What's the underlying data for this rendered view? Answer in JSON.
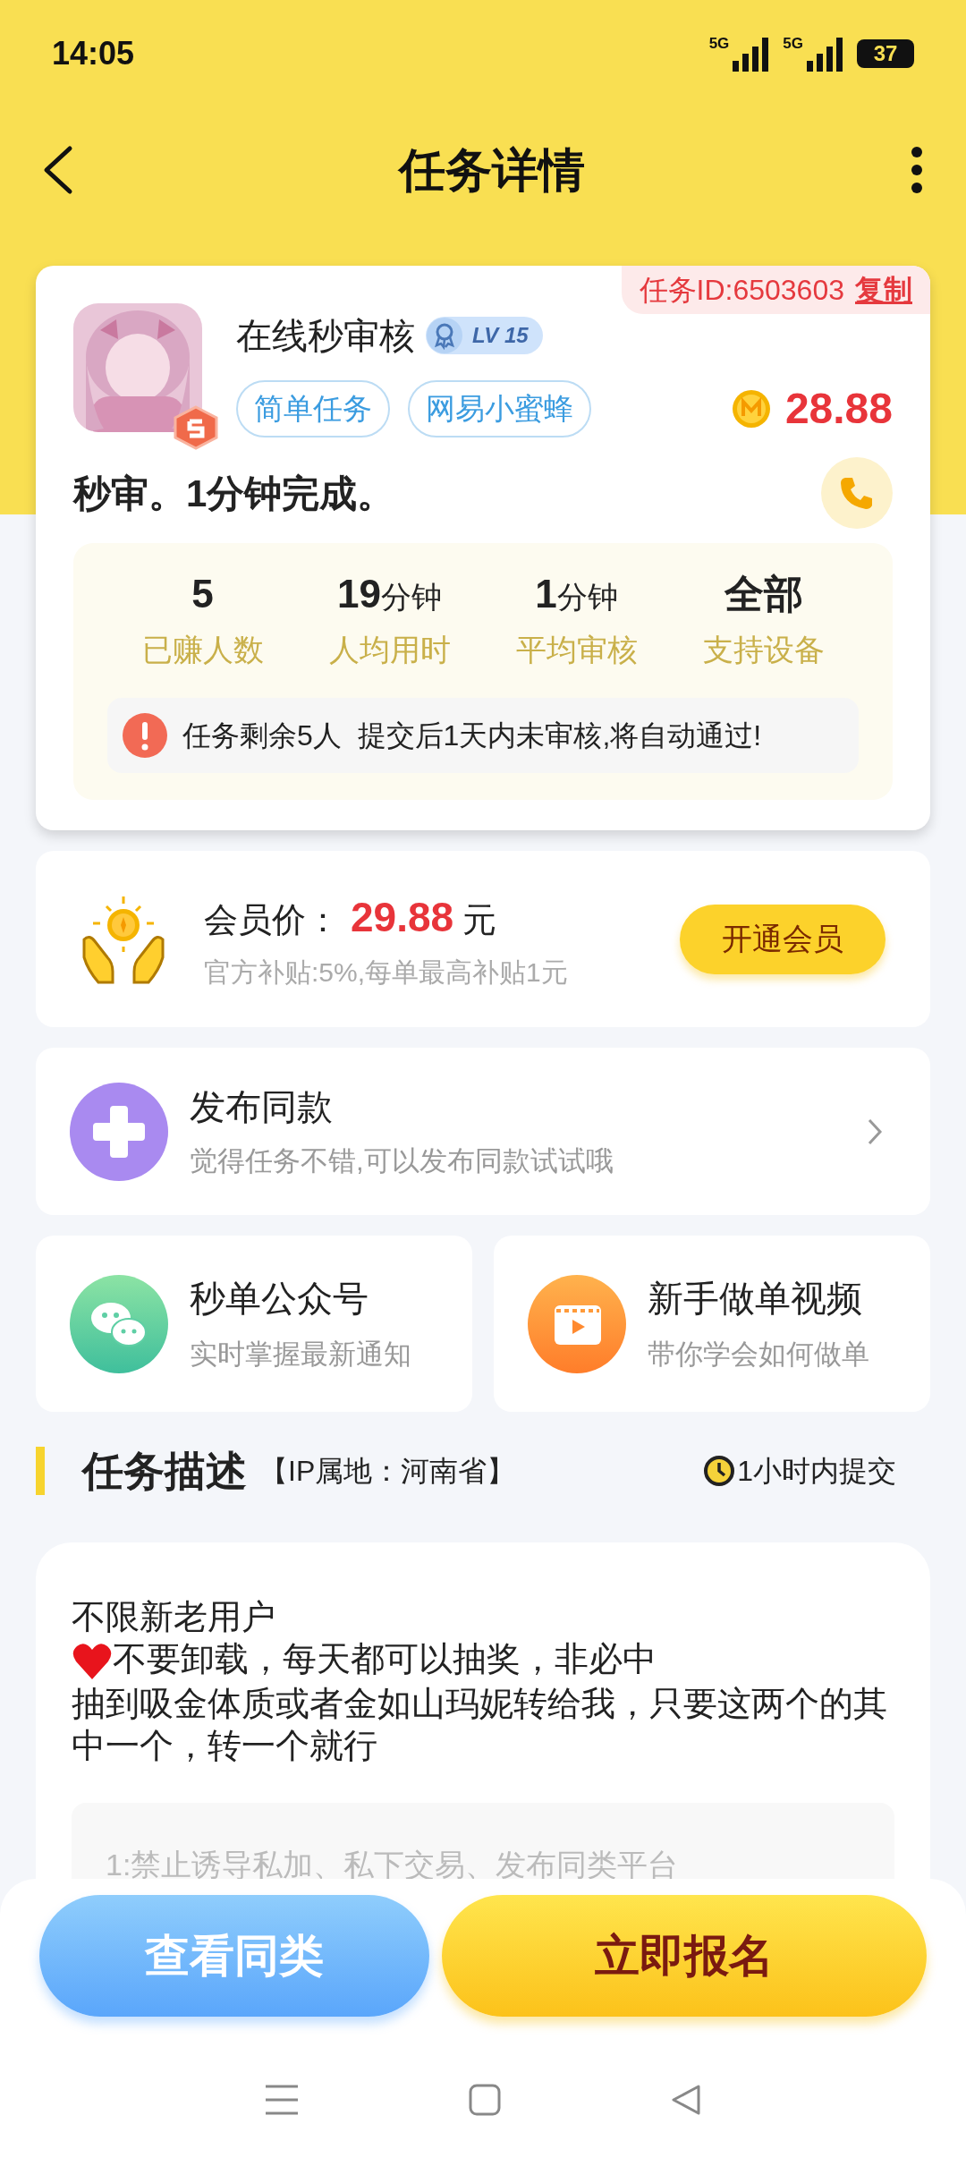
{
  "status_bar": {
    "time": "14:05",
    "signals": [
      "5G",
      "5G"
    ],
    "battery": "37"
  },
  "header": {
    "title": "任务详情"
  },
  "task": {
    "id_label": "任务ID:6503603",
    "copy": "复制",
    "name": "在线秒审核",
    "level": "LV 15",
    "tags": [
      "简单任务",
      "网易小蜜蜂"
    ],
    "reward": "28.88",
    "summary": "秒审。1分钟完成。",
    "stats": [
      {
        "value": "5",
        "label": "已赚人数"
      },
      {
        "value": "19",
        "unit": "分钟",
        "label": "人均用时"
      },
      {
        "value": "1",
        "unit": "分钟",
        "label": "平均审核"
      },
      {
        "value": "全部",
        "label": "支持设备"
      }
    ],
    "notice": "任务剩余5人  提交后1天内未审核,将自动通过!"
  },
  "membership": {
    "label": "会员价：",
    "price": "29.88",
    "currency": "元",
    "subsidy": "官方补贴:5%,每单最高补贴1元",
    "button": "开通会员"
  },
  "publish": {
    "title": "发布同款",
    "subtitle": "觉得任务不错,可以发布同款试试哦"
  },
  "shortcuts": [
    {
      "kind": "chat",
      "title": "秒单公众号",
      "subtitle": "实时掌握最新通知"
    },
    {
      "kind": "video",
      "title": "新手做单视频",
      "subtitle": "带你学会如何做单"
    }
  ],
  "description": {
    "title": "任务描述",
    "ip": "【IP属地：河南省】",
    "deadline": "1小时内提交",
    "lines": [
      {
        "heart": false,
        "text": "不限新老用户"
      },
      {
        "heart": true,
        "text": "不要卸载，每天都可以抽奖，非必中"
      },
      {
        "heart": false,
        "text": "抽到吸金体质或者金如山玛妮转给我，只要这两个的其中一个，转一个就行"
      }
    ],
    "rule": "1:禁止诱导私加、私下交易、发布同类平台"
  },
  "actions": [
    {
      "kind": "secondary",
      "label": "查看同类"
    },
    {
      "kind": "primary",
      "label": "立即报名"
    }
  ]
}
